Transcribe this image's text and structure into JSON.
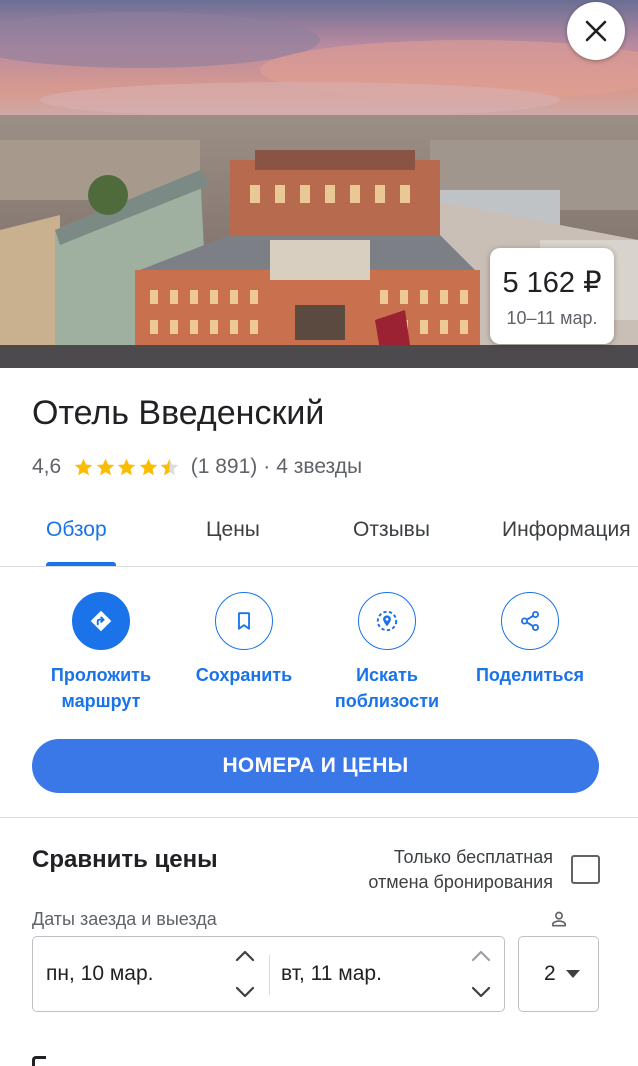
{
  "hero": {
    "close_icon": "close-icon",
    "price": "5 162 ₽",
    "price_dates": "10–11 мар."
  },
  "hotel": {
    "name": "Отель Введенский",
    "rating": "4,6",
    "rating_value": 4.6,
    "reviews_count": "(1 891)",
    "separator": "·",
    "stars_text": "4 звезды"
  },
  "tabs": [
    {
      "label": "Обзор",
      "active": true
    },
    {
      "label": "Цены",
      "active": false
    },
    {
      "label": "Отзывы",
      "active": false
    },
    {
      "label": "Информация",
      "active": false
    }
  ],
  "actions": [
    {
      "label_line1": "Проложить",
      "label_line2": "маршрут",
      "icon": "directions-icon"
    },
    {
      "label_line1": "Сохранить",
      "label_line2": "",
      "icon": "bookmark-icon"
    },
    {
      "label_line1": "Искать",
      "label_line2": "поблизости",
      "icon": "nearby-search-icon"
    },
    {
      "label_line1": "Поделиться",
      "label_line2": "",
      "icon": "share-icon"
    }
  ],
  "rooms_button": "НОМЕРА И ЦЕНЫ",
  "compare": {
    "title": "Сравнить цены",
    "free_cancel_line1": "Только бесплатная",
    "free_cancel_line2": "отмена бронирования",
    "free_cancel_checked": false,
    "dates_label": "Даты заезда и выезда",
    "check_in": "пн, 10 мар.",
    "check_out": "вт, 11 мар.",
    "guests": "2"
  },
  "colors": {
    "accent": "#1a73e8",
    "button": "#3b78e7",
    "star": "#fbbc04",
    "text": "#202124",
    "secondary": "#5f6368"
  }
}
